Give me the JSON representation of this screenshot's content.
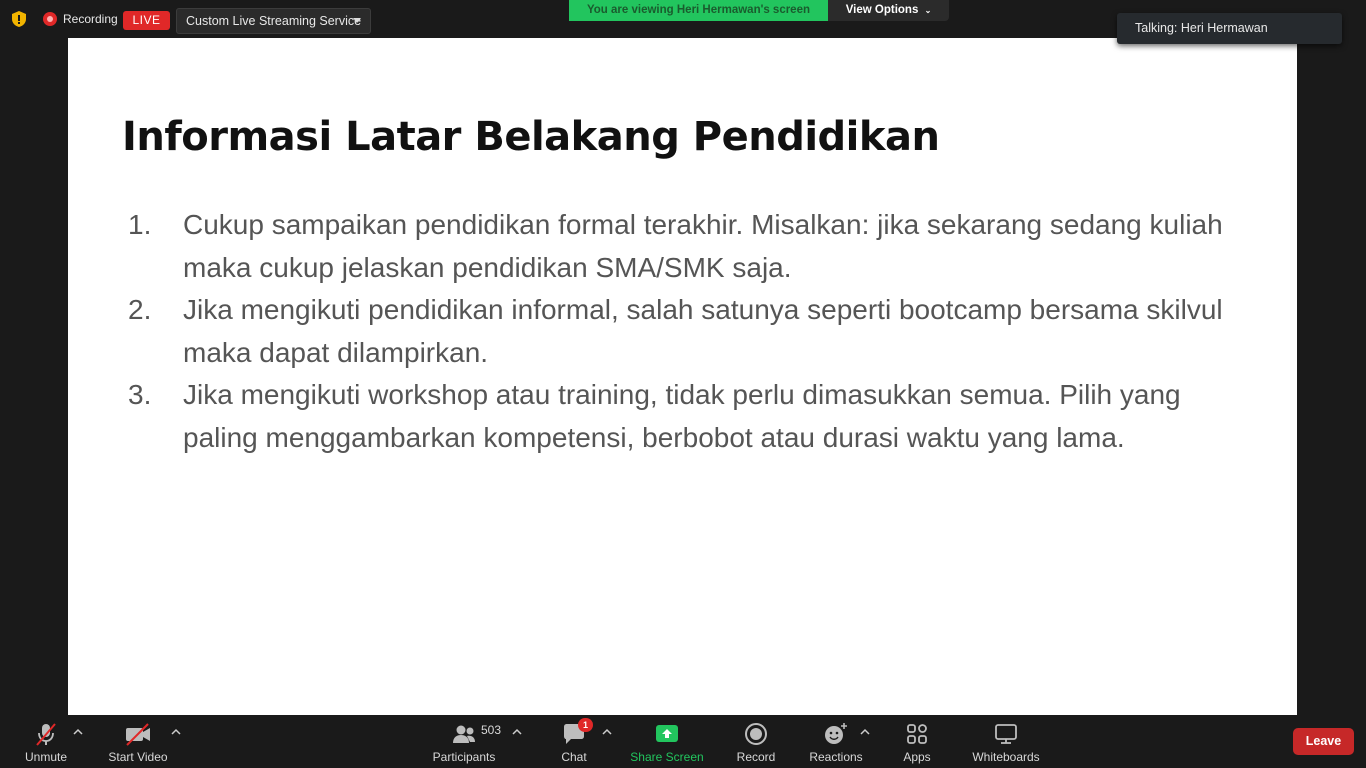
{
  "top": {
    "recording_label": "Recording",
    "live_label": "LIVE",
    "stream_service": "Custom Live Streaming Service",
    "viewing_banner": "You are viewing Heri Hermawan's screen",
    "view_options": "View Options",
    "talking": "Talking: Heri Hermawan",
    "view_stub": "w"
  },
  "slide": {
    "title": "Informasi Latar Belakang Pendidikan",
    "items": [
      {
        "num": "1.",
        "text": "Cukup sampaikan pendidikan formal terakhir.  Misalkan: jika sekarang sedang kuliah maka cukup jelaskan pendidikan SMA/SMK saja."
      },
      {
        "num": "2.",
        "text": "Jika mengikuti pendidikan informal, salah satunya seperti bootcamp bersama skilvul maka dapat dilampirkan."
      },
      {
        "num": "3.",
        "text": "Jika mengikuti workshop atau training, tidak perlu dimasukkan semua. Pilih yang paling menggambarkan kompetensi, berbobot atau durasi waktu yang lama."
      }
    ]
  },
  "toolbar": {
    "unmute": "Unmute",
    "start_video": "Start Video",
    "participants": "Participants",
    "participant_count": "503",
    "chat": "Chat",
    "chat_unread": "1",
    "share_screen": "Share Screen",
    "record": "Record",
    "reactions": "Reactions",
    "apps": "Apps",
    "whiteboards": "Whiteboards",
    "leave": "Leave"
  },
  "colors": {
    "share_green": "#22c55e",
    "live_red": "#e02828",
    "leave_red": "#c62828"
  }
}
